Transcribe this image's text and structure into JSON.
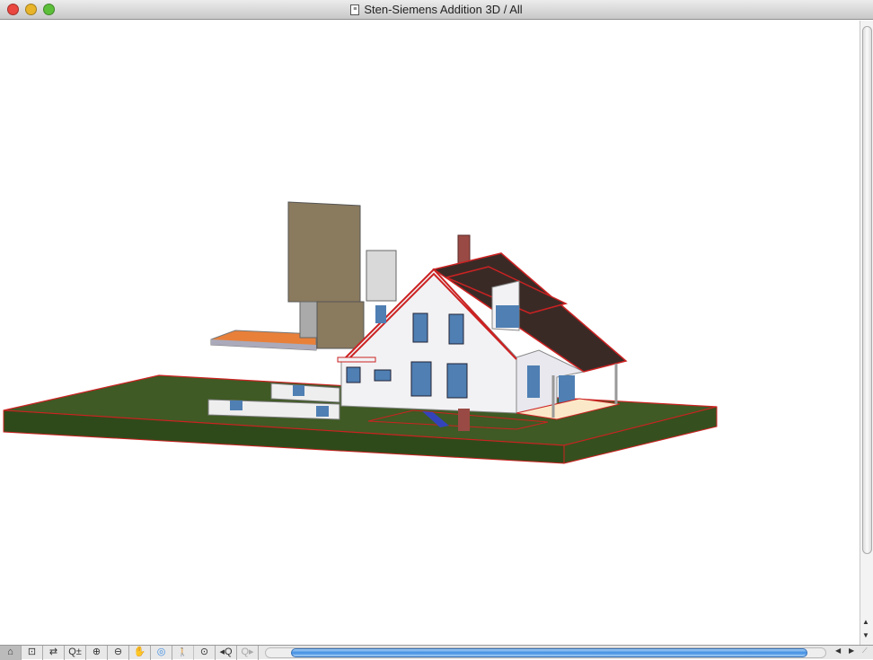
{
  "window": {
    "title": "Sten-Siemens Addition 3D / All"
  },
  "toolbar": {
    "tools": [
      {
        "icon": "3d-window-icon",
        "glyph": "⌂",
        "selected": true
      },
      {
        "icon": "zoom-area-icon",
        "glyph": "⊡"
      },
      {
        "icon": "navigator-preview-icon",
        "glyph": "⇄"
      },
      {
        "icon": "zoom-plus-minus-icon",
        "glyph": "Q±"
      },
      {
        "icon": "zoom-in-icon",
        "glyph": "⊕"
      },
      {
        "icon": "zoom-out-icon",
        "glyph": "⊖"
      },
      {
        "icon": "pan-hand-icon",
        "glyph": "✋"
      },
      {
        "icon": "orbit-icon",
        "glyph": "◎"
      },
      {
        "icon": "walk-icon",
        "glyph": "🚶"
      },
      {
        "icon": "fit-in-window-icon",
        "glyph": "⊙"
      },
      {
        "icon": "previous-zoom-icon",
        "glyph": "◂Q"
      },
      {
        "icon": "next-zoom-icon",
        "glyph": "Q▸"
      }
    ]
  },
  "colors": {
    "grass": "#3f5a24",
    "outline": "#cc2222",
    "roof": "#3a2a26",
    "siding": "#f2f2f4",
    "window": "#4f7fb3",
    "scroll": "#3f8ee3"
  }
}
